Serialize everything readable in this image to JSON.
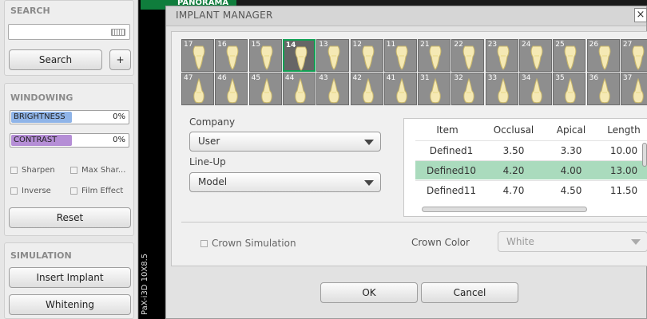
{
  "sidebar": {
    "search": {
      "title": "SEARCH",
      "button": "Search",
      "plus": "+"
    },
    "windowing": {
      "title": "WINDOWING",
      "brightness_label": "BRIGHTNESS",
      "brightness_value": "0%",
      "contrast_label": "CONTRAST",
      "contrast_value": "0%",
      "brightness_fill": 0.52,
      "contrast_fill": 0.52,
      "options": [
        "Sharpen",
        "Max Shar...",
        "Inverse",
        "Film Effect"
      ],
      "reset": "Reset"
    },
    "simulation": {
      "title": "SIMULATION",
      "insert": "Insert Implant",
      "whitening": "Whitening"
    }
  },
  "viewer": {
    "top_tab": "PANORAMA",
    "vertical_label": "PaX-i3D 10X8.5"
  },
  "dialog": {
    "title": "IMPLANT MANAGER",
    "close": "×",
    "teeth_upper": [
      "17",
      "16",
      "15",
      "14",
      "13",
      "12",
      "11",
      "21",
      "22",
      "23",
      "24",
      "25",
      "26",
      "27"
    ],
    "teeth_lower": [
      "47",
      "46",
      "45",
      "44",
      "43",
      "42",
      "41",
      "31",
      "32",
      "33",
      "34",
      "35",
      "36",
      "37"
    ],
    "selected_tooth": "14",
    "company_label": "Company",
    "company_value": "User",
    "lineup_label": "Line-Up",
    "lineup_value": "Model",
    "table": {
      "headers": [
        "Item",
        "Occlusal",
        "Apical",
        "Length"
      ],
      "rows": [
        [
          "Defined1",
          "3.50",
          "3.30",
          "10.00"
        ],
        [
          "Defined10",
          "4.20",
          "4.00",
          "13.00"
        ],
        [
          "Defined11",
          "4.70",
          "4.50",
          "11.50"
        ]
      ],
      "selected_row": 1
    },
    "crown_sim_label": "Crown Simulation",
    "crown_color_label": "Crown Color",
    "crown_color_value": "White",
    "ok": "OK",
    "cancel": "Cancel"
  }
}
